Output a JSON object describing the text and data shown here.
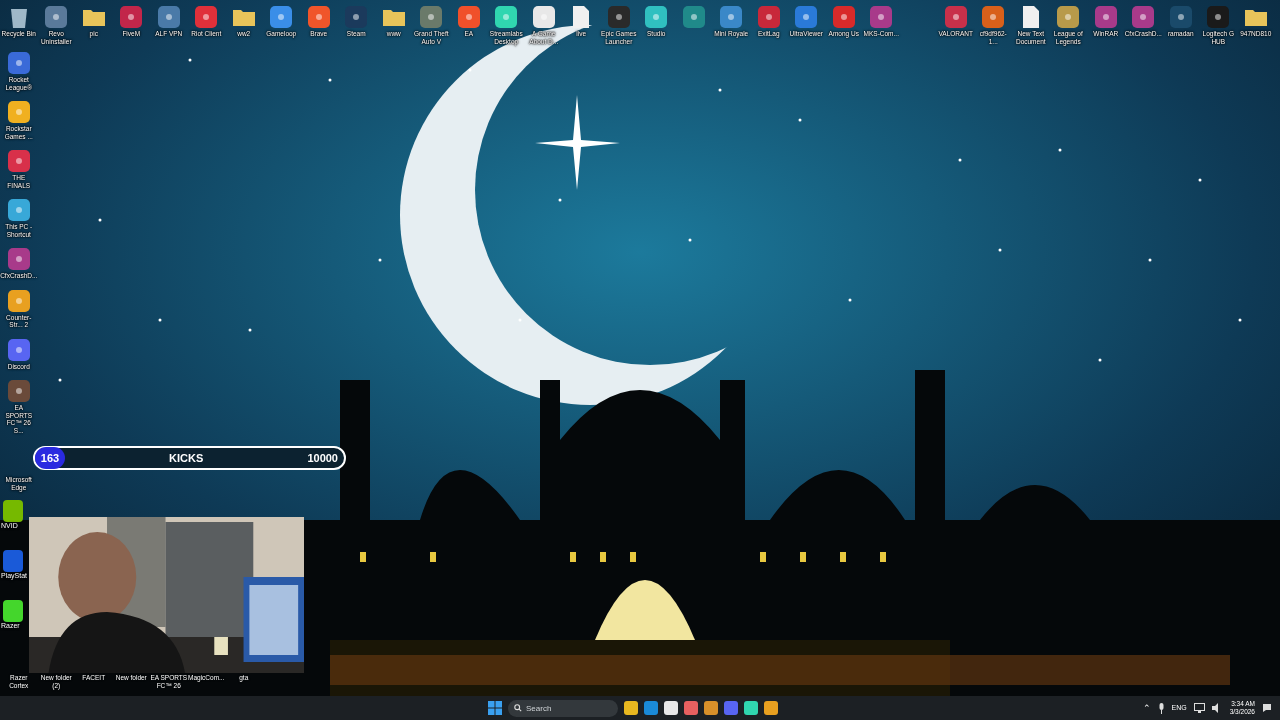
{
  "desktop": {
    "top_icons": [
      {
        "label": "Recycle Bin",
        "kind": "bin",
        "color": "#9fb8c8"
      },
      {
        "label": "Revo Uninstaller",
        "kind": "app",
        "color": "#5a7a9a"
      },
      {
        "label": "pic",
        "kind": "folder",
        "color": "#e8c45a"
      },
      {
        "label": "FiveM",
        "kind": "app",
        "color": "#c2264a"
      },
      {
        "label": "ALF VPN",
        "kind": "app",
        "color": "#4a7aa8"
      },
      {
        "label": "Riot Client",
        "kind": "app",
        "color": "#e0303a"
      },
      {
        "label": "ww2",
        "kind": "folder",
        "color": "#e8c45a"
      },
      {
        "label": "Gameloop",
        "kind": "app",
        "color": "#3a8ee8"
      },
      {
        "label": "Brave",
        "kind": "app",
        "color": "#f0552a"
      },
      {
        "label": "Steam",
        "kind": "app",
        "color": "#1b3a5c"
      },
      {
        "label": "www",
        "kind": "folder",
        "color": "#e8c45a"
      },
      {
        "label": "Grand Theft Auto V",
        "kind": "app",
        "color": "#6a7a6a"
      },
      {
        "label": "EA",
        "kind": "app",
        "color": "#f0502a"
      },
      {
        "label": "Streamlabs Desktop",
        "kind": "app",
        "color": "#30d6b0"
      },
      {
        "label": "A Game About D...",
        "kind": "app",
        "color": "#e8e8e8"
      },
      {
        "label": "live",
        "kind": "file",
        "color": "#f0f0f0"
      },
      {
        "label": "Epic Games Launcher",
        "kind": "app",
        "color": "#2a2a2a"
      },
      {
        "label": "Studio",
        "kind": "app",
        "color": "#30c0c0"
      },
      {
        "kind": "app",
        "color": "#208a8a"
      },
      {
        "label": "Mini Royale",
        "kind": "app",
        "color": "#3a88c8"
      },
      {
        "label": "ExitLag",
        "kind": "app",
        "color": "#c8283a"
      },
      {
        "label": "UltraViewer",
        "kind": "app",
        "color": "#2a7ad8"
      },
      {
        "label": "Among Us",
        "kind": "app",
        "color": "#d82a2a"
      },
      {
        "label": "MKS-Com...",
        "kind": "app",
        "color": "#a83a8a"
      }
    ],
    "right_icons": [
      {
        "label": "VALORANT",
        "kind": "app",
        "color": "#c8304a"
      },
      {
        "label": "cf9df962-1...",
        "kind": "app",
        "color": "#d8601a"
      },
      {
        "label": "New Text Document",
        "kind": "file",
        "color": "#f0f0f0"
      },
      {
        "label": "League of Legends",
        "kind": "app",
        "color": "#b89a4a"
      },
      {
        "label": "WinRAR",
        "kind": "app",
        "color": "#a83a8a"
      },
      {
        "label": "CfxCrashD...",
        "kind": "app",
        "color": "#a83a8a"
      },
      {
        "label": "ramadan",
        "kind": "app",
        "color": "#1a4a6a"
      },
      {
        "label": "Logitech G HUB",
        "kind": "app",
        "color": "#1a1a1a"
      },
      {
        "label": "947ND810",
        "kind": "folder",
        "color": "#e8c45a"
      }
    ],
    "left_icons": [
      {
        "label": "Rocket League®",
        "kind": "app",
        "color": "#3a6ad8"
      },
      {
        "label": "Rockstar Games ...",
        "kind": "app",
        "color": "#f0b020"
      },
      {
        "label": "THE FINALS",
        "kind": "app",
        "color": "#d8304a"
      },
      {
        "label": "This PC - Shortcut",
        "kind": "app",
        "color": "#38a8d8"
      },
      {
        "label": "CfxCrashD...",
        "kind": "app",
        "color": "#a83a8a"
      },
      {
        "label": "Counter-Str... 2",
        "kind": "app",
        "color": "#e8a020"
      },
      {
        "label": "Discord",
        "kind": "app",
        "color": "#5865f2"
      },
      {
        "label": "EA SPORTS FC™ 26 S...",
        "kind": "app",
        "color": "#6a4a3a"
      },
      {
        "label": "Microsoft Edge",
        "kind": "covered"
      }
    ],
    "cut_icons": [
      {
        "label": "NVID",
        "color": "#76b900"
      },
      {
        "label": "PlayStat",
        "color": "#1a5ad8"
      },
      {
        "label": "Razer",
        "color": "#44d62c"
      }
    ],
    "bottom_labels": [
      "Razer Cortex",
      "New folder (2)",
      "FACEIT",
      "New folder",
      "EA SPORTS FC™ 26",
      "MagicCom...",
      "gta"
    ]
  },
  "kicks_goal": {
    "count": "163",
    "label": "KICKS",
    "goal": "10000"
  },
  "taskbar": {
    "search": {
      "placeholder": "Search"
    },
    "apps": [
      {
        "color": "#e8b820"
      },
      {
        "color": "#1a8ad8"
      },
      {
        "color": "#e8e8e8"
      },
      {
        "color": "#e86060"
      },
      {
        "color": "#d8902a"
      },
      {
        "color": "#5865f2"
      },
      {
        "color": "#30d6b0"
      },
      {
        "color": "#e8a020"
      }
    ],
    "tray_toggle": "⌃",
    "language": "ENG",
    "time": "3:34 AM",
    "date": "3/3/2026"
  }
}
